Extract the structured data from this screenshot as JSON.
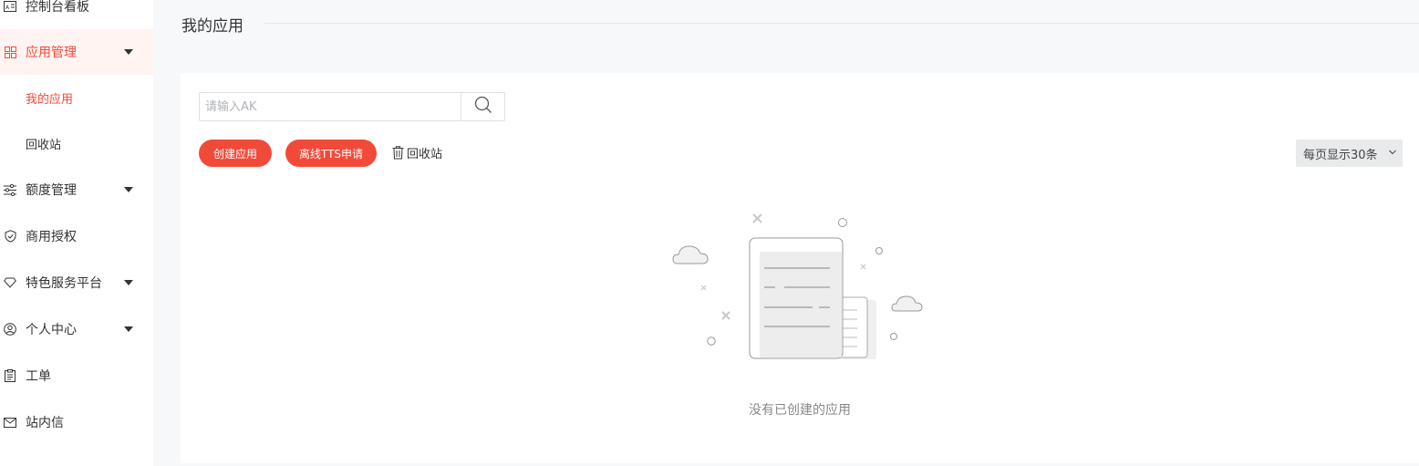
{
  "sidebar": {
    "items": [
      {
        "label": "控制台看板",
        "icon": "dashboard-icon"
      },
      {
        "label": "应用管理",
        "icon": "grid-apps-icon",
        "expanded": true
      },
      {
        "label": "我的应用",
        "sub": true,
        "active": true
      },
      {
        "label": "回收站",
        "sub": true
      },
      {
        "label": "额度管理",
        "icon": "sliders-icon",
        "caret": true
      },
      {
        "label": "商用授权",
        "icon": "shield-check-icon"
      },
      {
        "label": "特色服务平台",
        "icon": "diamond-icon",
        "caret": true
      },
      {
        "label": "个人中心",
        "icon": "user-circle-icon",
        "caret": true
      },
      {
        "label": "工单",
        "icon": "clipboard-icon"
      },
      {
        "label": "站内信",
        "icon": "mail-icon"
      }
    ]
  },
  "header": {
    "title": "我的应用"
  },
  "search": {
    "placeholder": "请输入AK",
    "value": ""
  },
  "toolbar": {
    "create_label": "创建应用",
    "offline_tts_label": "离线TTS申请",
    "recycle_label": "回收站",
    "page_size_label": "每页显示30条"
  },
  "empty": {
    "text": "没有已创建的应用"
  },
  "colors": {
    "accent": "#f24a39",
    "muted": "#888888",
    "border": "#dcdfe6"
  }
}
